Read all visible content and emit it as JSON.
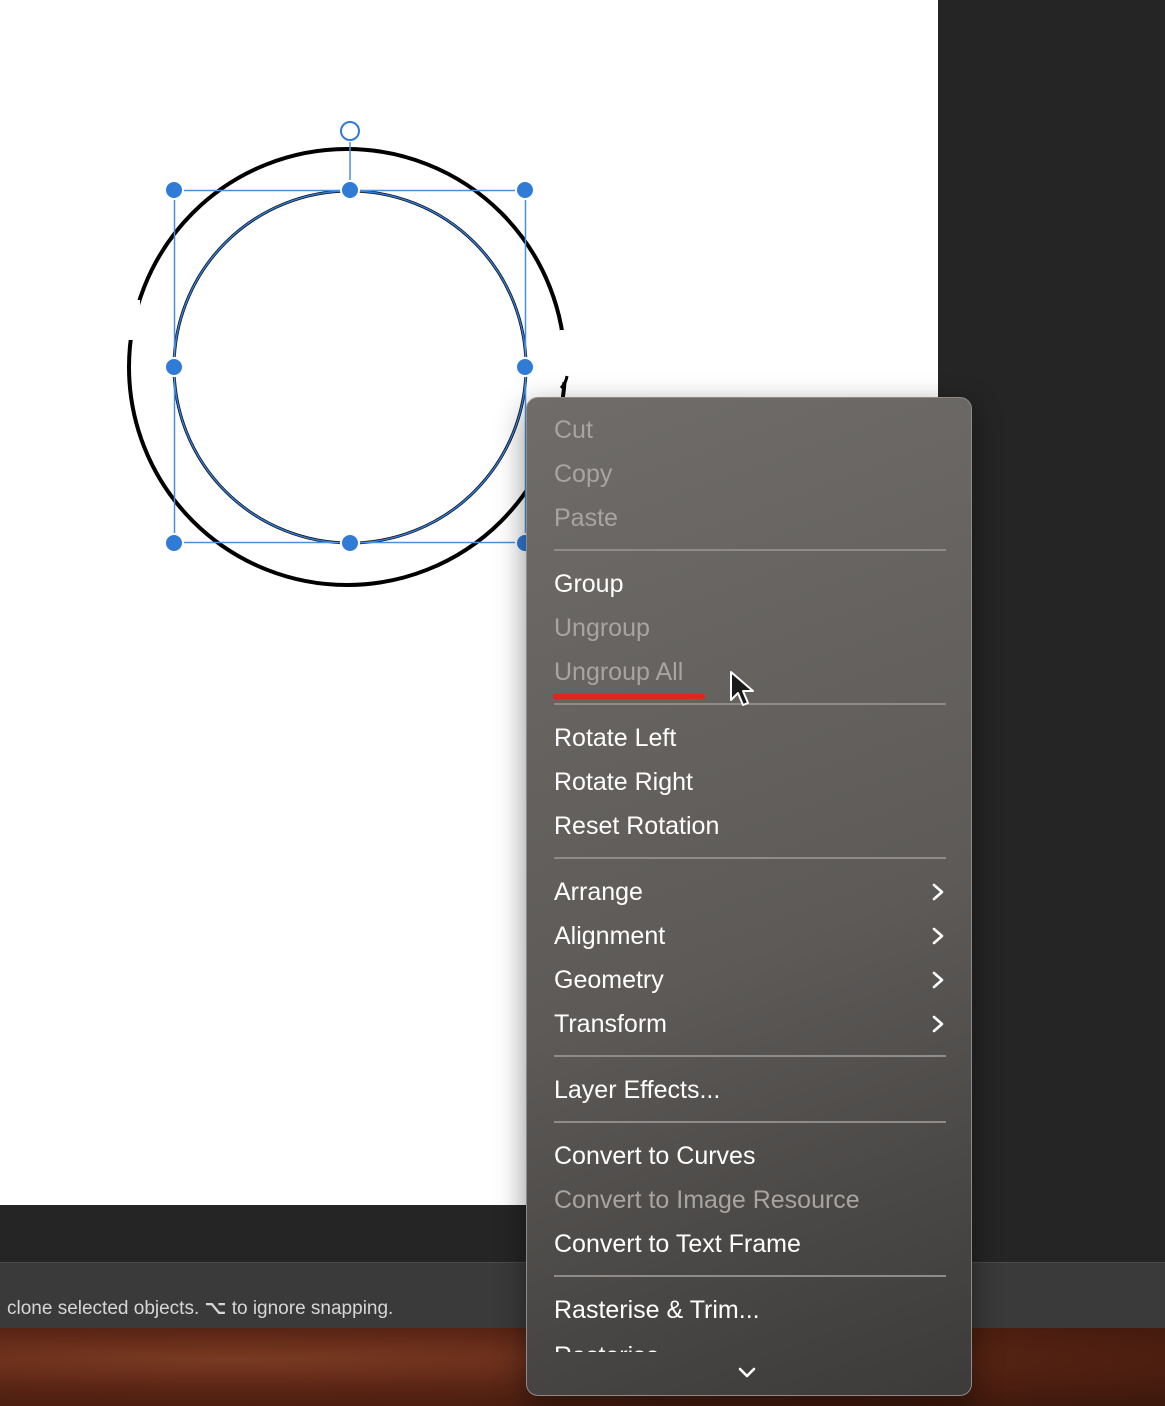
{
  "status_bar": {
    "hint_prefix": "clone selected objects.",
    "option_key_glyph": "⌥",
    "hint_suffix": "to ignore snapping."
  },
  "context_menu": {
    "items": [
      {
        "label": "Cut",
        "enabled": false
      },
      {
        "label": "Copy",
        "enabled": false
      },
      {
        "label": "Paste",
        "enabled": false
      },
      {
        "label": "Group",
        "enabled": true
      },
      {
        "label": "Ungroup",
        "enabled": false
      },
      {
        "label": "Ungroup All",
        "enabled": false
      },
      {
        "label": "Rotate Left",
        "enabled": true
      },
      {
        "label": "Rotate Right",
        "enabled": true
      },
      {
        "label": "Reset Rotation",
        "enabled": true
      },
      {
        "label": "Arrange",
        "enabled": true,
        "submenu": true
      },
      {
        "label": "Alignment",
        "enabled": true,
        "submenu": true
      },
      {
        "label": "Geometry",
        "enabled": true,
        "submenu": true
      },
      {
        "label": "Transform",
        "enabled": true,
        "submenu": true
      },
      {
        "label": "Layer Effects...",
        "enabled": true
      },
      {
        "label": "Convert to Curves",
        "enabled": true
      },
      {
        "label": "Convert to Image Resource",
        "enabled": false
      },
      {
        "label": "Convert to Text Frame",
        "enabled": true
      },
      {
        "label": "Rasterise & Trim...",
        "enabled": true
      },
      {
        "label": "Rasterise",
        "enabled": true
      }
    ]
  },
  "colors": {
    "selection_blue": "#2f7bd6",
    "annotation_red": "#e0251b"
  },
  "icons": {
    "submenu": "chevron-right-icon",
    "more": "chevron-down-icon",
    "pointer": "arrow-cursor-icon",
    "rotate_handle": "rotation-handle-icon"
  }
}
